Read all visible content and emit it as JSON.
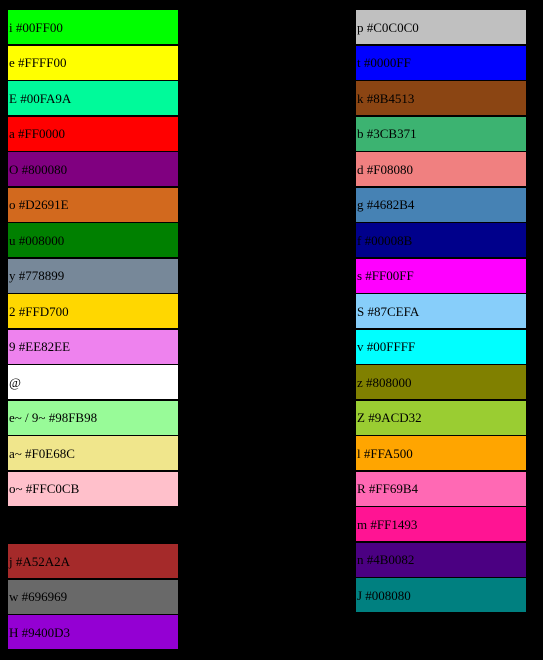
{
  "left_column": [
    {
      "label": "i #00FF00",
      "color": "#00FF00"
    },
    {
      "label": "e #FFFF00",
      "color": "#FFFF00"
    },
    {
      "label": "E #00FA9A",
      "color": "#00FA9A"
    },
    {
      "label": "a #FF0000",
      "color": "#FF0000"
    },
    {
      "label": "O #800080",
      "color": "#800080"
    },
    {
      "label": "o #D2691E",
      "color": "#D2691E"
    },
    {
      "label": "u #008000",
      "color": "#008000"
    },
    {
      "label": "y #778899",
      "color": "#778899"
    },
    {
      "label": "2 #FFD700",
      "color": "#FFD700"
    },
    {
      "label": "9 #EE82EE",
      "color": "#EE82EE"
    },
    {
      "label": "@",
      "color": "#FFFFFF"
    },
    {
      "label": "e~ / 9~ #98FB98",
      "color": "#98FB98"
    },
    {
      "label": "a~ #F0E68C",
      "color": "#F0E68C"
    },
    {
      "label": "o~ #FFC0CB",
      "color": "#FFC0CB"
    },
    {
      "label": "",
      "color": "#000000"
    },
    {
      "label": "j #A52A2A",
      "color": "#A52A2A"
    },
    {
      "label": "w #696969",
      "color": "#696969"
    },
    {
      "label": "H #9400D3",
      "color": "#9400D3"
    }
  ],
  "right_column": [
    {
      "label": "p #C0C0C0",
      "color": "#C0C0C0"
    },
    {
      "label": "t #0000FF",
      "color": "#0000FF"
    },
    {
      "label": "k #8B4513",
      "color": "#8B4513"
    },
    {
      "label": "b #3CB371",
      "color": "#3CB371"
    },
    {
      "label": "d #F08080",
      "color": "#F08080"
    },
    {
      "label": "g #4682B4",
      "color": "#4682B4"
    },
    {
      "label": "f #00008B",
      "color": "#00008B"
    },
    {
      "label": "s #FF00FF",
      "color": "#FF00FF"
    },
    {
      "label": "S #87CEFA",
      "color": "#87CEFA"
    },
    {
      "label": "v #00FFFF",
      "color": "#00FFFF"
    },
    {
      "label": "z #808000",
      "color": "#808000"
    },
    {
      "label": "Z #9ACD32",
      "color": "#9ACD32"
    },
    {
      "label": "l #FFA500",
      "color": "#FFA500"
    },
    {
      "label": "R #FF69B4",
      "color": "#FF69B4"
    },
    {
      "label": "m #FF1493",
      "color": "#FF1493"
    },
    {
      "label": "n #4B0082",
      "color": "#4B0082"
    },
    {
      "label": "J #008080",
      "color": "#008080"
    }
  ]
}
